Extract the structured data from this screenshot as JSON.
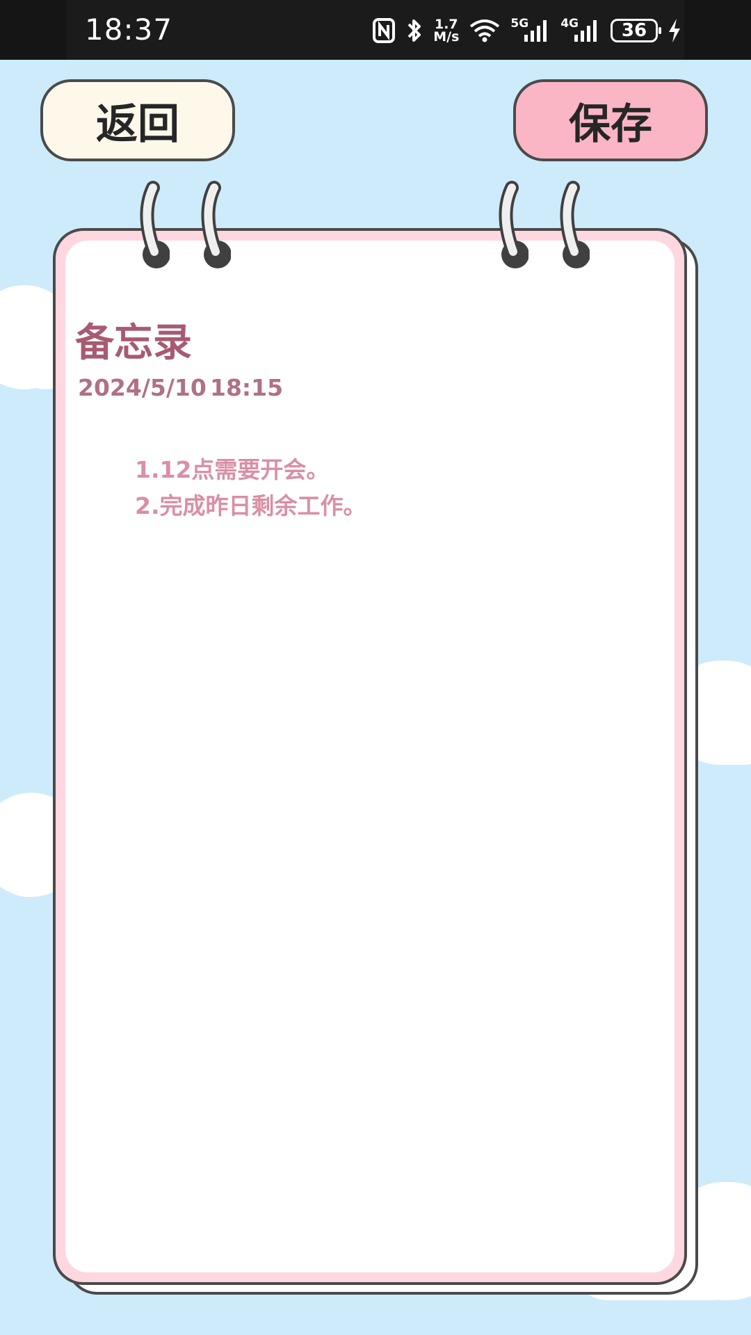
{
  "status_bar": {
    "time": "18:37",
    "speed_value": "1.7",
    "speed_unit": "M/s",
    "net_5g": "5G",
    "net_4g": "4G",
    "battery": "36"
  },
  "header": {
    "back_label": "返回",
    "save_label": "保存"
  },
  "memo": {
    "title": "备忘录",
    "date": "2024/5/10",
    "time": "18:15",
    "content": "1.12点需要开会。\n2.完成昨日剩余工作。"
  },
  "colors": {
    "background": "#cdebfb",
    "back_button": "#fdf8ea",
    "save_button": "#fbb6c6",
    "title": "#a85a72",
    "content": "#d98fa4"
  }
}
